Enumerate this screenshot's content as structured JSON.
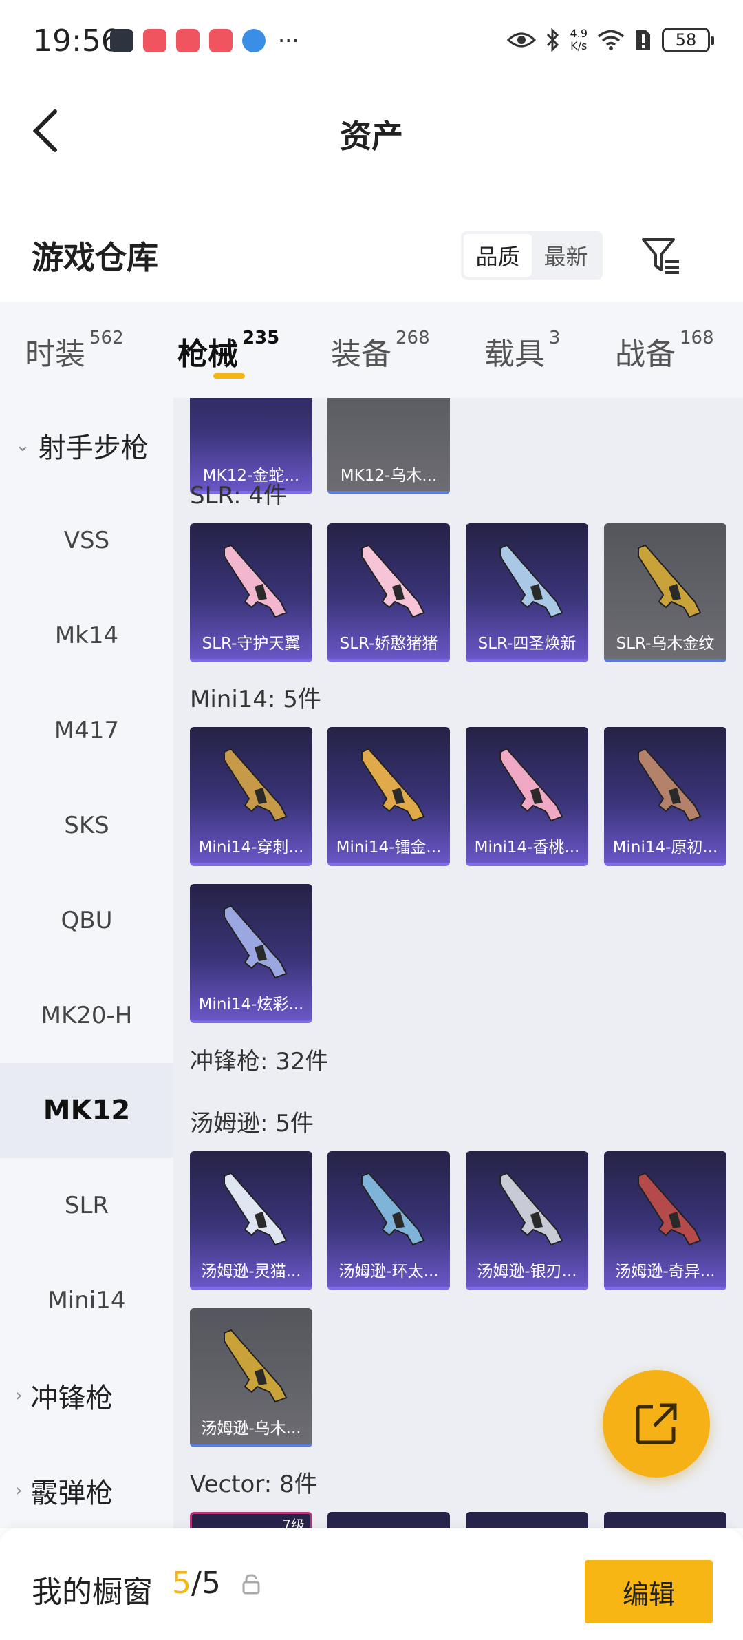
{
  "status_bar": {
    "time": "19:56",
    "network_speed": "4.9",
    "network_unit": "K/s",
    "battery": "58",
    "more": "···"
  },
  "header": {
    "title": "资产"
  },
  "warehouse": {
    "title": "游戏仓库",
    "sort_options": [
      "品质",
      "最新"
    ],
    "active_sort": "品质"
  },
  "tabs": [
    {
      "label": "时装",
      "count": "562"
    },
    {
      "label": "枪械",
      "count": "235",
      "active": true
    },
    {
      "label": "装备",
      "count": "268"
    },
    {
      "label": "载具",
      "count": "3"
    },
    {
      "label": "战备",
      "count": "168"
    }
  ],
  "sidebar": [
    {
      "label": "射手步枪",
      "type": "group-expanded"
    },
    {
      "label": "VSS"
    },
    {
      "label": "Mk14"
    },
    {
      "label": "M417"
    },
    {
      "label": "SKS"
    },
    {
      "label": "QBU"
    },
    {
      "label": "MK20-H"
    },
    {
      "label": "MK12",
      "active": true
    },
    {
      "label": "SLR"
    },
    {
      "label": "Mini14"
    },
    {
      "label": "冲锋枪",
      "type": "group-collapsed"
    },
    {
      "label": "霰弹枪",
      "type": "group-collapsed"
    }
  ],
  "content": {
    "mk12_partial": [
      {
        "name": "MK12-金蛇...",
        "style": "purple"
      },
      {
        "name": "MK12-乌木...",
        "style": "gray"
      }
    ],
    "slr_label": "SLR: 4件",
    "slr": [
      {
        "name": "SLR-守护天翼",
        "style": "purple",
        "tint": "#f2b6cf"
      },
      {
        "name": "SLR-娇憨猪猪",
        "style": "purple",
        "tint": "#f6c4d6"
      },
      {
        "name": "SLR-四圣焕新",
        "style": "purple",
        "tint": "#a9c8e6"
      },
      {
        "name": "SLR-乌木金纹",
        "style": "gray",
        "tint": "#c9a23a"
      }
    ],
    "mini14_label": "Mini14: 5件",
    "mini14": [
      {
        "name": "Mini14-穿刺...",
        "style": "purple",
        "tint": "#c79a4a"
      },
      {
        "name": "Mini14-镭金...",
        "style": "purple",
        "tint": "#e0a94a"
      },
      {
        "name": "Mini14-香桃...",
        "style": "purple",
        "tint": "#f0a9c4"
      },
      {
        "name": "Mini14-原初...",
        "style": "purple",
        "tint": "#b4826a"
      },
      {
        "name": "Mini14-炫彩...",
        "style": "purple",
        "tint": "#9aa7e0"
      }
    ],
    "smg_label": "冲锋枪: 32件",
    "thompson_label": "汤姆逊: 5件",
    "thompson": [
      {
        "name": "汤姆逊-灵猫...",
        "style": "purple",
        "tint": "#dfe6f2"
      },
      {
        "name": "汤姆逊-环太...",
        "style": "purple",
        "tint": "#7fb3d8"
      },
      {
        "name": "汤姆逊-银刃...",
        "style": "purple",
        "tint": "#c8cbd6"
      },
      {
        "name": "汤姆逊-奇异...",
        "style": "purple",
        "tint": "#b54a4a"
      },
      {
        "name": "汤姆逊-乌木...",
        "style": "gray",
        "tint": "#c9a23a"
      }
    ],
    "vector_label": "Vector: 8件",
    "vector_badge": "7级"
  },
  "bottom_bar": {
    "label": "我的橱窗",
    "current": "5",
    "total": "/5",
    "edit": "编辑"
  },
  "colors": {
    "accent": "#f5b512",
    "purple_card": "#3a3478",
    "gray_card": "#6c6c72"
  }
}
